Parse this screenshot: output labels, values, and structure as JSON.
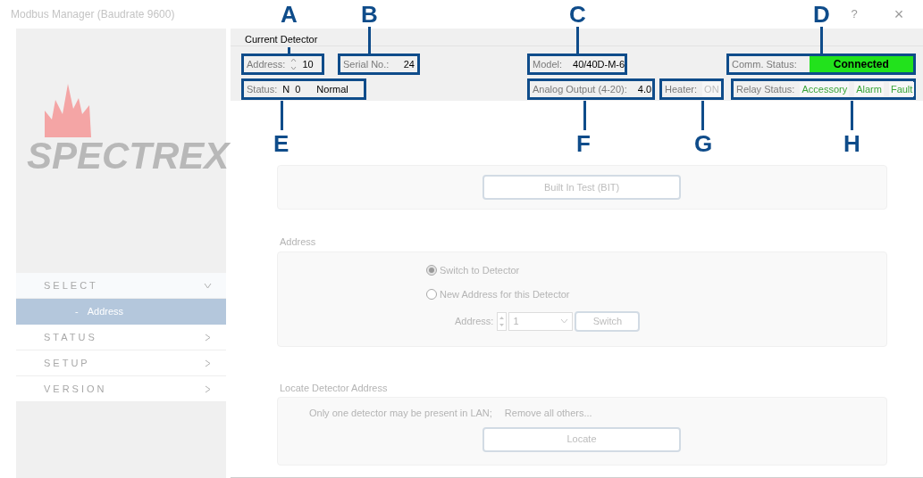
{
  "window": {
    "title": "Modbus Manager (Baudrate 9600)",
    "help": "?",
    "close": "×"
  },
  "logo": {
    "text": "SPECTREX"
  },
  "menu": [
    {
      "label": "SELECT",
      "expanded": true,
      "children": [
        {
          "marker": "-",
          "label": "Address",
          "selected": true
        }
      ]
    },
    {
      "label": "STATUS",
      "expanded": false
    },
    {
      "label": "SETUP",
      "expanded": false
    },
    {
      "label": "VERSION",
      "expanded": false
    }
  ],
  "current_detector": {
    "title": "Current Detector",
    "fields": [
      {
        "kind": "spin",
        "label": "Address:",
        "value": "10"
      },
      {
        "kind": "plain",
        "label": "Serial No.:",
        "value": "24"
      },
      {
        "kind": "plain",
        "label": "Model:",
        "value": "40/40D-M-6"
      },
      {
        "kind": "comm",
        "label": "Comm. Status:",
        "value": "Connected"
      },
      {
        "kind": "status",
        "label": "Status:",
        "parts": [
          "N",
          "0",
          "Normal"
        ]
      },
      {
        "kind": "plain",
        "label": "Analog Output (4-20):",
        "value": "4.0"
      },
      {
        "kind": "heater",
        "label": "Heater:",
        "value": "ON",
        "active": false
      },
      {
        "kind": "relay",
        "label": "Relay Status:",
        "items": [
          {
            "label": "Accessory",
            "active": true
          },
          {
            "label": "Alarm",
            "active": true
          },
          {
            "label": "Fault",
            "active": true
          }
        ]
      }
    ]
  },
  "callouts": [
    {
      "letter": "A"
    },
    {
      "letter": "B"
    },
    {
      "letter": "C"
    },
    {
      "letter": "D"
    },
    {
      "letter": "E"
    },
    {
      "letter": "F"
    },
    {
      "letter": "G"
    },
    {
      "letter": "H"
    }
  ],
  "bit_group": {
    "button": "Built In Test (BIT)"
  },
  "address_group": {
    "title": "Address",
    "options": [
      {
        "label": "Switch to Detector",
        "selected": true
      },
      {
        "label": "New Address for this Detector",
        "selected": false
      }
    ],
    "address_label": "Address:",
    "address_value": "1",
    "switch_button": "Switch"
  },
  "locate_group": {
    "title": "Locate Detector Address",
    "message": "Only one detector may be present in LAN;",
    "message_2": "Remove all others...",
    "button": "Locate"
  }
}
